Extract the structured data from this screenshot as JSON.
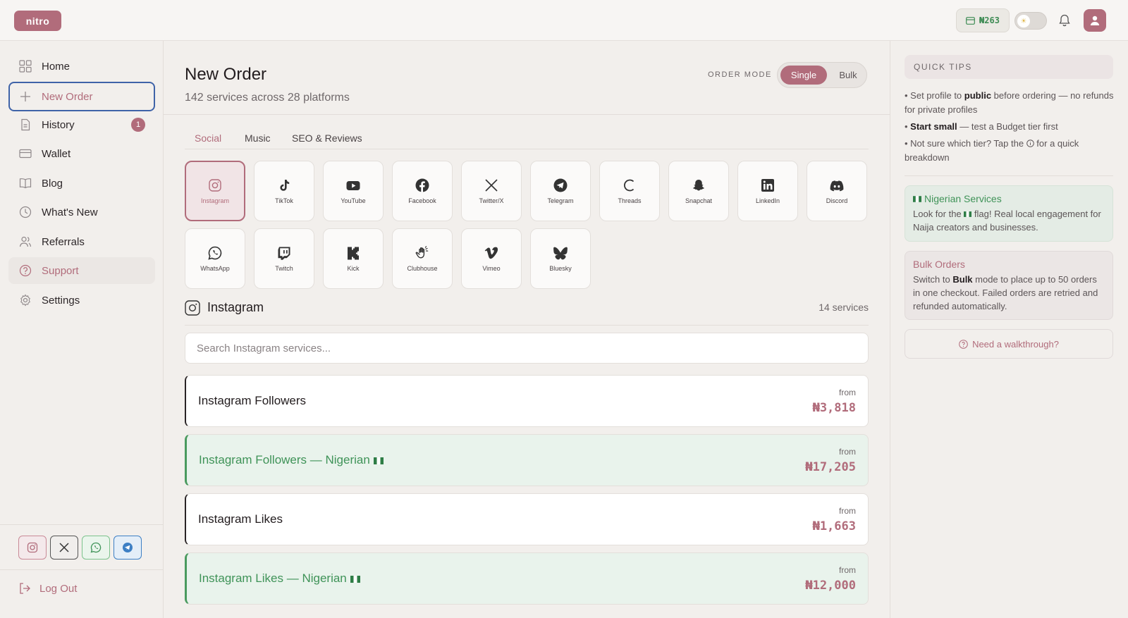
{
  "app": {
    "logo_text": "nitro"
  },
  "topbar": {
    "balance": "₦263"
  },
  "sidebar": {
    "items": [
      {
        "label": "Home"
      },
      {
        "label": "New Order"
      },
      {
        "label": "History",
        "badge": "1"
      },
      {
        "label": "Wallet"
      },
      {
        "label": "Blog"
      },
      {
        "label": "What's New"
      },
      {
        "label": "Referrals"
      },
      {
        "label": "Support"
      },
      {
        "label": "Settings"
      }
    ],
    "logout_label": "Log Out"
  },
  "main": {
    "title": "New Order",
    "subtitle": "142 services across 28 platforms",
    "order_mode_label": "ORDER MODE",
    "mode_single": "Single",
    "mode_bulk": "Bulk",
    "tabs": [
      {
        "label": "Social"
      },
      {
        "label": "Music"
      },
      {
        "label": "SEO & Reviews"
      }
    ],
    "platforms": [
      {
        "label": "Instagram"
      },
      {
        "label": "TikTok"
      },
      {
        "label": "YouTube"
      },
      {
        "label": "Facebook"
      },
      {
        "label": "Twitter/X"
      },
      {
        "label": "Telegram"
      },
      {
        "label": "Threads"
      },
      {
        "label": "Snapchat"
      },
      {
        "label": "LinkedIn"
      },
      {
        "label": "Discord"
      },
      {
        "label": "WhatsApp"
      },
      {
        "label": "Twitch"
      },
      {
        "label": "Kick"
      },
      {
        "label": "Clubhouse"
      },
      {
        "label": "Vimeo"
      },
      {
        "label": "Bluesky"
      }
    ],
    "section_title": "Instagram",
    "section_count": "14 services",
    "search_placeholder": "Search Instagram services...",
    "services": [
      {
        "name": "Instagram Followers",
        "from": "from",
        "price": "₦3,818",
        "nigerian": false
      },
      {
        "name": "Instagram Followers — Nigerian",
        "from": "from",
        "price": "₦17,205",
        "nigerian": true
      },
      {
        "name": "Instagram Likes",
        "from": "from",
        "price": "₦1,663",
        "nigerian": false
      },
      {
        "name": "Instagram Likes — Nigerian",
        "from": "from",
        "price": "₦12,000",
        "nigerian": true
      }
    ]
  },
  "quick_tips": {
    "heading": "QUICK TIPS",
    "tip1": {
      "a": "Set profile to ",
      "b": "public",
      "c": " before ordering — no refunds for private profiles"
    },
    "tip2": {
      "b": "Start small",
      "c": " — test a Budget tier first"
    },
    "tip3": {
      "a": "Not sure which tier? Tap the ",
      "c": " for a quick breakdown"
    },
    "nigerian_card": {
      "title": "Nigerian Services",
      "text_a": "Look for the ",
      "text_b": " flag! Real local engagement for Naija creators and businesses."
    },
    "bulk_card": {
      "title": "Bulk Orders",
      "text_a": "Switch to ",
      "text_b": "Bulk",
      "text_c": " mode to place up to 50 orders in one checkout. Failed orders are retried and refunded automatically."
    },
    "walkthrough": "Need a walkthrough?"
  },
  "colors": {
    "accent": "#b16c7b",
    "green": "#3f9358",
    "focus": "#3f63a8"
  }
}
